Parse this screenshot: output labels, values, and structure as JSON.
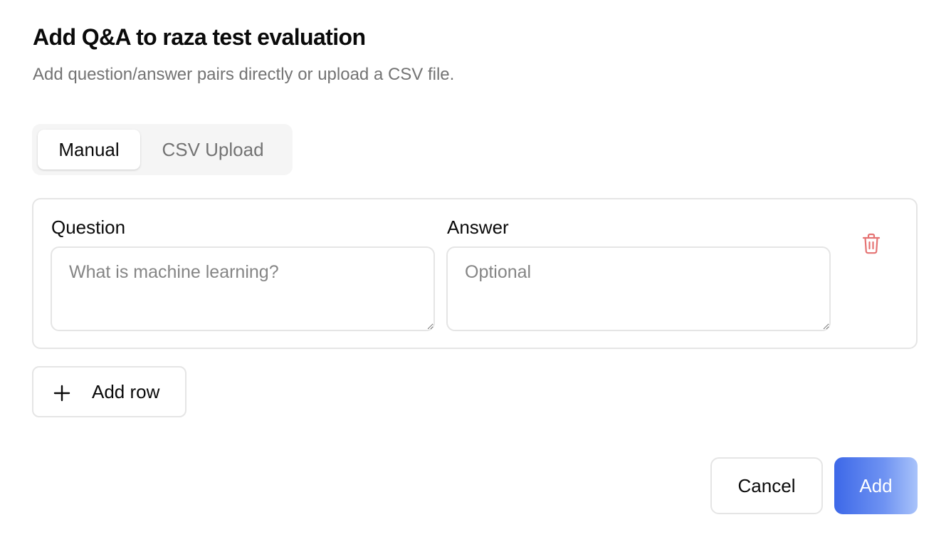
{
  "dialog": {
    "title": "Add Q&A to raza test evaluation",
    "subtitle": "Add question/answer pairs directly or upload a CSV file."
  },
  "tabs": [
    {
      "label": "Manual",
      "active": true
    },
    {
      "label": "CSV Upload",
      "active": false
    }
  ],
  "qa_row": {
    "question_label": "Question",
    "question_placeholder": "What is machine learning?",
    "question_value": "",
    "answer_label": "Answer",
    "answer_placeholder": "Optional",
    "answer_value": "",
    "delete_icon": "trash-icon"
  },
  "add_row": {
    "label": "Add row",
    "icon": "plus-icon"
  },
  "footer": {
    "cancel_label": "Cancel",
    "add_label": "Add"
  },
  "colors": {
    "primary_gradient_start": "#3d68e8",
    "primary_gradient_end": "#a9c3fa",
    "danger_icon": "#e57373",
    "muted_text": "#737373",
    "border": "#e5e5e5"
  }
}
